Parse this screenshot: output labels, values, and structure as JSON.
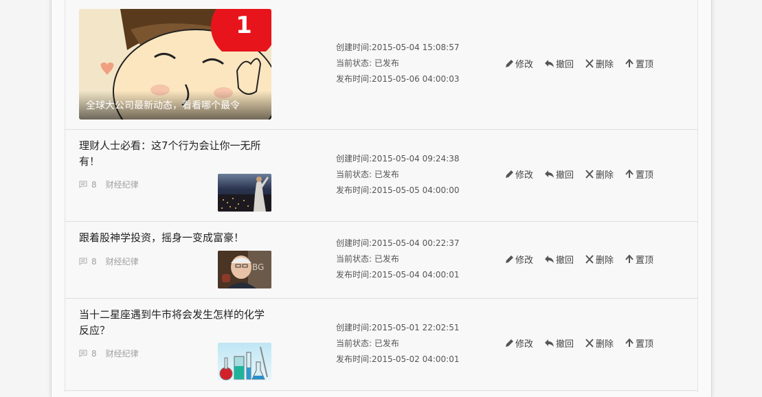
{
  "articles": [
    {
      "type": "cover",
      "caption": "全球大公司最新动态，看看哪个最令",
      "badge": "1",
      "created": "创建时间:2015-05-04 15:08:57",
      "status": "当前状态: 已发布",
      "published": "发布时间:2015-05-06 04:00:03"
    },
    {
      "type": "list",
      "title": "理财人士必看：这7个行为会让你一无所有！",
      "comments": "8",
      "category": "财经纪律",
      "created": "创建时间:2015-05-04 09:24:38",
      "status": "当前状态: 已发布",
      "published": "发布时间:2015-05-05 04:00:00"
    },
    {
      "type": "list",
      "title": "跟着股神学投资，摇身一变成富豪！",
      "comments": "8",
      "category": "财经纪律",
      "created": "创建时间:2015-05-04 00:22:37",
      "status": "当前状态: 已发布",
      "published": "发布时间:2015-05-04 04:00:01"
    },
    {
      "type": "list",
      "title": "当十二星座遇到牛市将会发生怎样的化学反应？",
      "comments": "8",
      "category": "财经纪律",
      "created": "创建时间:2015-05-01 22:02:51",
      "status": "当前状态: 已发布",
      "published": "发布时间:2015-05-02 04:00:01"
    }
  ],
  "actions": {
    "edit": "修改",
    "revoke": "撤回",
    "delete": "删除",
    "pin": "置顶"
  },
  "colors": {
    "badge": "#e8141b",
    "text": "#222222",
    "muted": "#a0a0a0"
  }
}
